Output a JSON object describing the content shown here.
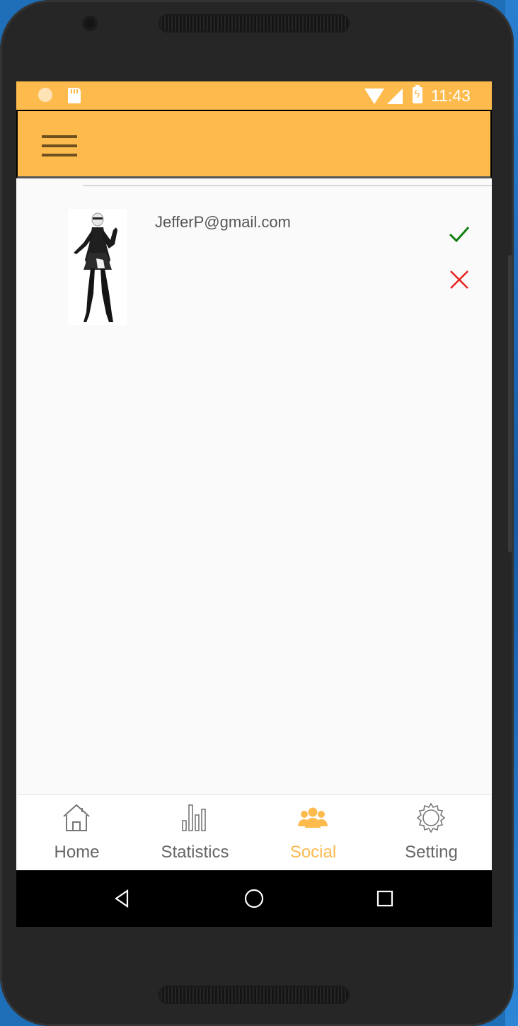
{
  "status_bar": {
    "time": "11:43"
  },
  "app_bar": {
    "menu_icon": "hamburger-menu-icon"
  },
  "friend_requests": [
    {
      "email": "JefferP@gmail.com",
      "avatar_icon": "character-figure-avatar",
      "accept_icon": "check-icon",
      "reject_icon": "close-icon"
    }
  ],
  "bottom_nav": {
    "items": [
      {
        "label": "Home",
        "icon": "home-icon",
        "active": false
      },
      {
        "label": "Statistics",
        "icon": "bar-chart-icon",
        "active": false
      },
      {
        "label": "Social",
        "icon": "people-icon",
        "active": true
      },
      {
        "label": "Setting",
        "icon": "gear-icon",
        "active": false
      }
    ]
  },
  "colors": {
    "accent": "#fdbb4e",
    "accept": "#108010",
    "reject": "#e8231e",
    "menu_lines": "#6e4f1f",
    "inactive_text": "#666666"
  }
}
